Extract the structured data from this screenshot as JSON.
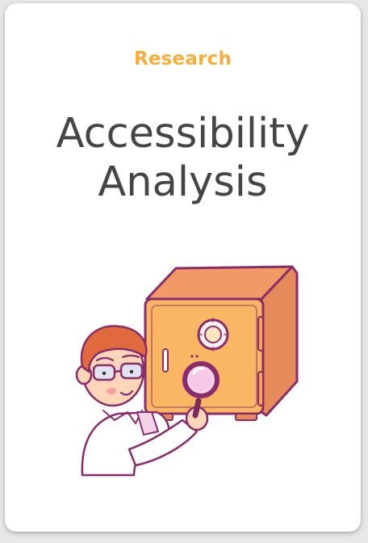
{
  "card": {
    "category": "Research",
    "title_line1": "Accessibility",
    "title_line2": "Analysis"
  },
  "colors": {
    "accent": "#f7ae3b",
    "title": "#454545",
    "safe_front": "#fbb664",
    "safe_side": "#e58a59",
    "outline": "#8a2c6b"
  },
  "illustration": {
    "subject": "person-with-magnifier-and-safe"
  }
}
